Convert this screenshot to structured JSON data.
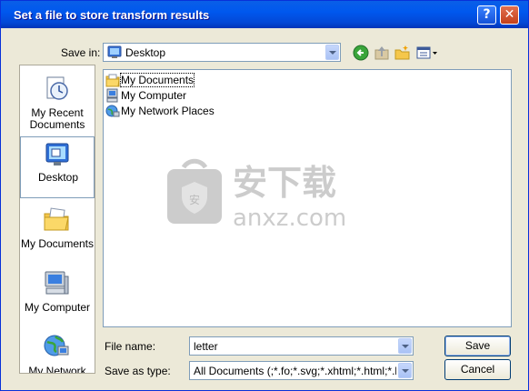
{
  "window": {
    "title": "Set a file to store transform results"
  },
  "title_buttons": {
    "help": "?",
    "close": "✕"
  },
  "save_in": {
    "label": "Save in:",
    "value": "Desktop"
  },
  "toolbar": {
    "back": "back-icon",
    "up": "up-folder-icon",
    "new_folder": "new-folder-icon",
    "views": "views-menu-icon"
  },
  "places": [
    {
      "label": "My Recent Documents",
      "icon": "recent-documents-icon"
    },
    {
      "label": "Desktop",
      "icon": "desktop-icon",
      "selected": true
    },
    {
      "label": "My Documents",
      "icon": "my-documents-icon"
    },
    {
      "label": "My Computer",
      "icon": "my-computer-icon"
    },
    {
      "label": "My Network",
      "icon": "my-network-icon"
    }
  ],
  "files": [
    {
      "name": "My Documents",
      "icon": "documents-folder-icon"
    },
    {
      "name": "My Computer",
      "icon": "computer-icon"
    },
    {
      "name": "My Network Places",
      "icon": "network-icon"
    }
  ],
  "file_name": {
    "label": "File name:",
    "value": "letter"
  },
  "save_as_type": {
    "label": "Save as type:",
    "value": "All Documents (;*.fo;*.svg;*.xhtml;*.html;*.htm;*.:"
  },
  "buttons": {
    "save": "Save",
    "cancel": "Cancel"
  },
  "watermark": {
    "text_cn": "安下载",
    "text_en": "anxz.com"
  },
  "colors": {
    "titlebar": "#0058ee",
    "dialog_bg": "#ece9d8",
    "border": "#7f9db9"
  }
}
